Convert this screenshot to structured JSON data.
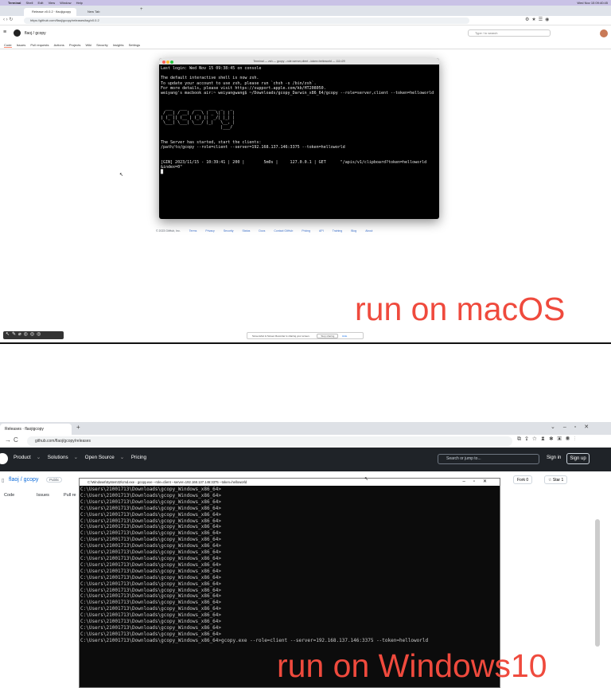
{
  "mac": {
    "menubar": {
      "app": "Terminal",
      "items": [
        "Shell",
        "Edit",
        "View",
        "Window",
        "Help"
      ],
      "clock": "Wed Nov 15 09:40:45"
    },
    "browser": {
      "tabs": [
        "Release v0.0.2 · flaojigcopy",
        "New Tab"
      ],
      "url": "https://github.com/flaoj/gcopy/releases/tag/v0.0.2"
    },
    "github": {
      "breadcrumb": "flaoj / gcopy",
      "search_placeholder": "Type / to search",
      "tabs": [
        "Code",
        "Issues",
        "Pull requests",
        "Actions",
        "Projects",
        "Wiki",
        "Security",
        "Insights",
        "Settings"
      ]
    },
    "terminal": {
      "title": "Terminal — zsh — gcopy --role=server,client --token=helloworld — 111×29",
      "lines": [
        "Last login: Wed Nov 15 09:38:45 on console",
        "",
        "The default interactive shell is now zsh.",
        "To update your account to use zsh, please run `chsh -s /bin/zsh`.",
        "For more details, please visit https://support.apple.com/kb/HT208050.",
        "weiyang's macbook air:~ weiyangwang$ ~/Downloads/gcopy_Darwin_x86_64/gcopy --role=server,client --token=helloworld",
        "",
        "",
        "  ___   ___   ___   ___  _   _",
        " / __| / __| / _ \\ | _ \\| | | |",
        "| (_ || (__ | (_) ||  _/| |_| |",
        " \\___| \\___| \\___/ |_|   \\__, |",
        "                         |___/",
        "",
        "",
        "The Server has started, start the clients:",
        "/path/to/gcopy --role=client --server=192.168.137.146:3375 --token=helloworld",
        "",
        "",
        "[GIN] 2023/11/15 - 10:39:41 | 200 |        5m0s |     127.0.0.1 | GET      \"/apis/v1/clipboard?token=helloworld",
        "&index=0\"",
        "█"
      ]
    },
    "footer": [
      "© 2023 GitHub, Inc.",
      "Terms",
      "Privacy",
      "Security",
      "Status",
      "Docs",
      "Contact GitHub",
      "Pricing",
      "API",
      "Training",
      "Blog",
      "About"
    ],
    "share_bar": {
      "text": "Screenshot & Screen Recorder is sharing your screen.",
      "stop": "Stop sharing",
      "hide": "Hide"
    },
    "caption": "run on macOS"
  },
  "win": {
    "browser": {
      "tab": "Releases · flaojigcopy",
      "url": "github.com/flaoj/gcopy/releases"
    },
    "github": {
      "nav": [
        "Product",
        "Solutions",
        "Open Source",
        "Pricing"
      ],
      "search_placeholder": "Search or jump to...",
      "sign_in": "Sign in",
      "sign_up": "Sign up",
      "repo": "flaoj / gcopy",
      "visibility": "Public",
      "tabs": [
        "Code",
        "Issues",
        "Pull re"
      ],
      "fork": "Fork",
      "fork_count": "0",
      "star": "Star",
      "star_count": "1"
    },
    "cmd": {
      "title": "C:\\Windows\\System32\\cmd.exe - gcopy.exe  --role=client --server=192.168.137.146:3375 --token=helloworld",
      "prompt": "C:\\Users\\21001713\\Downloads\\gcopy_Windows_x86_64>",
      "command": "C:\\Users\\21001713\\Downloads\\gcopy_Windows_x86_64>gcopy.exe --role=client --server=192.168.137.146:3375 --token=helloworld"
    },
    "caption": "run on Windows10"
  },
  "colors": {
    "caption": "#ef4a3d",
    "mac_menubar": "#c9c2e6",
    "gh_dark": "#1f2328",
    "terminal_bg": "#000000"
  }
}
